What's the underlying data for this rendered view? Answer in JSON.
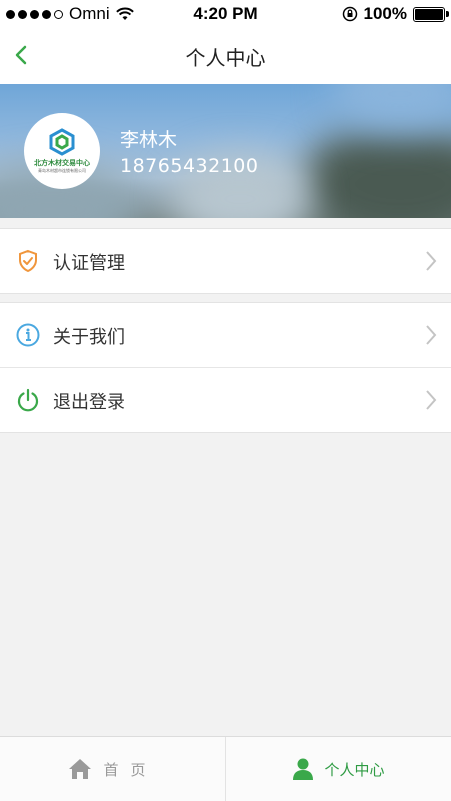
{
  "status_bar": {
    "carrier": "Omni",
    "time": "4:20 PM",
    "battery": "100%",
    "battery_level": 1.0
  },
  "nav": {
    "title": "个人中心"
  },
  "profile": {
    "logo_name": "北方木材交易中心",
    "logo_subtitle": "青岛木材超市连锁有限公司",
    "name": "李林木",
    "phone": "18765432100"
  },
  "menu": {
    "group1": [
      {
        "label": "认证管理",
        "icon": "shield-check-icon",
        "color": "#f0963c"
      }
    ],
    "group2": [
      {
        "label": "关于我们",
        "icon": "info-icon",
        "color": "#4aa8e0"
      },
      {
        "label": "退出登录",
        "icon": "power-icon",
        "color": "#3aa84a"
      }
    ]
  },
  "tabbar": {
    "home": {
      "label": "首页",
      "icon": "home-icon"
    },
    "me": {
      "label": "个人中心",
      "icon": "user-icon"
    }
  },
  "colors": {
    "accent": "#3aa84a",
    "background": "#f2f2f2"
  }
}
